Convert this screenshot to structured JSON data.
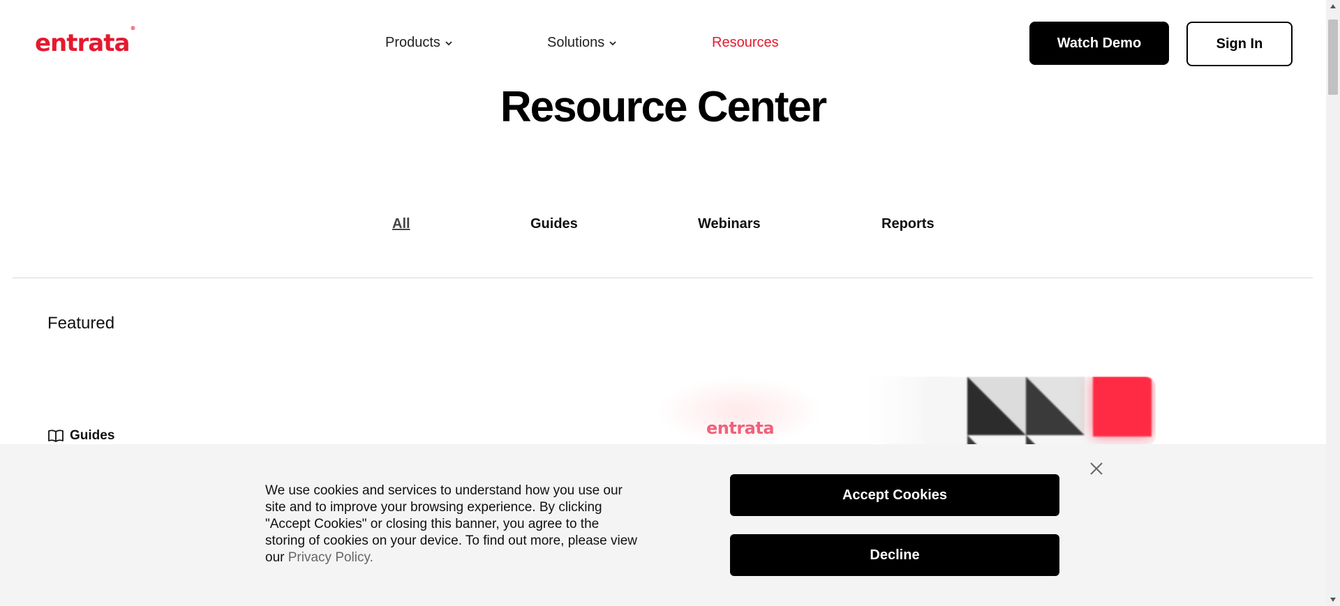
{
  "header": {
    "logo_text": "entrata",
    "logo_mark": "®",
    "nav": [
      {
        "label": "Products",
        "icon": "chevron-down-icon"
      },
      {
        "label": "Solutions",
        "icon": "chevron-down-icon"
      },
      {
        "label": "Resources"
      }
    ],
    "watch_demo": "Watch Demo",
    "sign_in": "Sign In"
  },
  "main": {
    "title": "Resource Center",
    "tabs": [
      {
        "label": "All"
      },
      {
        "label": "Guides"
      },
      {
        "label": "Webinars"
      },
      {
        "label": "Reports"
      }
    ],
    "featured_heading": "Featured",
    "featured_item": {
      "category_label": "Guides",
      "category_icon": "book-icon",
      "card_logo": "entrata"
    }
  },
  "cookie_banner": {
    "text": "We use cookies and services to understand how you use our site and to improve your browsing experience. By clicking \"Accept Cookies\" or closing this banner, you agree to the storing of cookies on your device. To find out more, please view our ",
    "privacy_link": "Privacy Policy.",
    "accept": "Accept Cookies",
    "decline": "Decline",
    "close_icon": "close-icon"
  },
  "colors": {
    "brand_red": "#e5192e",
    "accent_red": "#ff2a44",
    "black": "#000000",
    "banner_bg": "#f4f4f4"
  }
}
